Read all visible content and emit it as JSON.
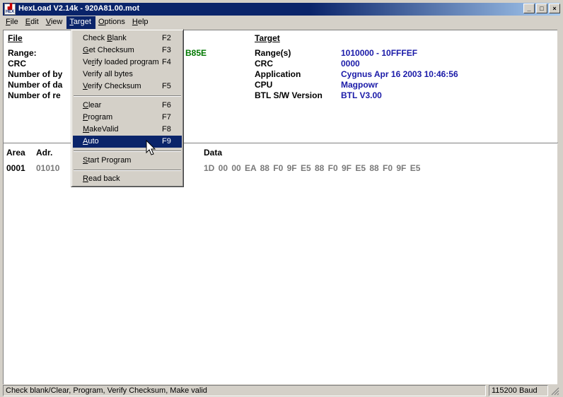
{
  "window": {
    "icon_text": "HEX",
    "title": "HexLoad V2.14k - 920A81.00.mot",
    "minimize": "_",
    "restore": "□",
    "close": "×"
  },
  "menu": {
    "file": {
      "pre": "",
      "u": "F",
      "post": "ile"
    },
    "edit": {
      "pre": "",
      "u": "E",
      "post": "dit"
    },
    "view": {
      "pre": "",
      "u": "V",
      "post": "iew"
    },
    "target": {
      "pre": "",
      "u": "T",
      "post": "arget"
    },
    "options": {
      "pre": "",
      "u": "O",
      "post": "ptions"
    },
    "help": {
      "pre": "",
      "u": "H",
      "post": "elp"
    }
  },
  "file_panel": {
    "header": "File",
    "range_label": "Range:",
    "crc_label": "CRC",
    "bytes_label": "Number of by",
    "data_label": "Number of da",
    "records_label": "Number of re",
    "crc_value_partial": "B85E"
  },
  "target_panel": {
    "header": "Target",
    "range_label": "Range(s)",
    "range_value": "1010000 - 10FFFEF",
    "crc_label": "CRC",
    "crc_value": "0000",
    "application_label": "Application",
    "application_value": "Cygnus Apr 16 2003 10:46:56",
    "cpu_label": "CPU",
    "cpu_value": "Magpowr",
    "btl_label": "BTL S/W Version",
    "btl_value": "BTL V3.00"
  },
  "data_table": {
    "col_area": "Area",
    "col_adr": "Adr.",
    "col_data": "Data",
    "row_area": "0001",
    "row_adr": "01010",
    "row_data": "1D 00 00 EA 88 F0 9F E5 88 F0 9F E5 88 F0 9F E5"
  },
  "target_menu": {
    "check_blank": {
      "pre": "Check ",
      "u": "B",
      "post": "lank",
      "key": "F2"
    },
    "get_checksum": {
      "pre": "",
      "u": "G",
      "post": "et Checksum",
      "key": "F3"
    },
    "verify_loaded": {
      "pre": "Ve",
      "u": "r",
      "post": "ify loaded program",
      "key": "F4"
    },
    "verify_all": {
      "label": "Verify all bytes",
      "key": ""
    },
    "verify_checksum": {
      "pre": "",
      "u": "V",
      "post": "erify Checksum",
      "key": "F5"
    },
    "clear": {
      "pre": "",
      "u": "C",
      "post": "lear",
      "key": "F6"
    },
    "program": {
      "pre": "",
      "u": "P",
      "post": "rogram",
      "key": "F7"
    },
    "make_valid": {
      "pre": "",
      "u": "M",
      "post": "akeValid",
      "key": "F8"
    },
    "auto": {
      "pre": "",
      "u": "A",
      "post": "uto",
      "key": "F9"
    },
    "start_program": {
      "pre": "",
      "u": "S",
      "post": "tart Program",
      "key": ""
    },
    "read_back": {
      "pre": "",
      "u": "R",
      "post": "ead back",
      "key": ""
    }
  },
  "status": {
    "message": "Check blank/Clear, Program, Verify Checksum, Make valid",
    "baud": "115200 Baud"
  }
}
